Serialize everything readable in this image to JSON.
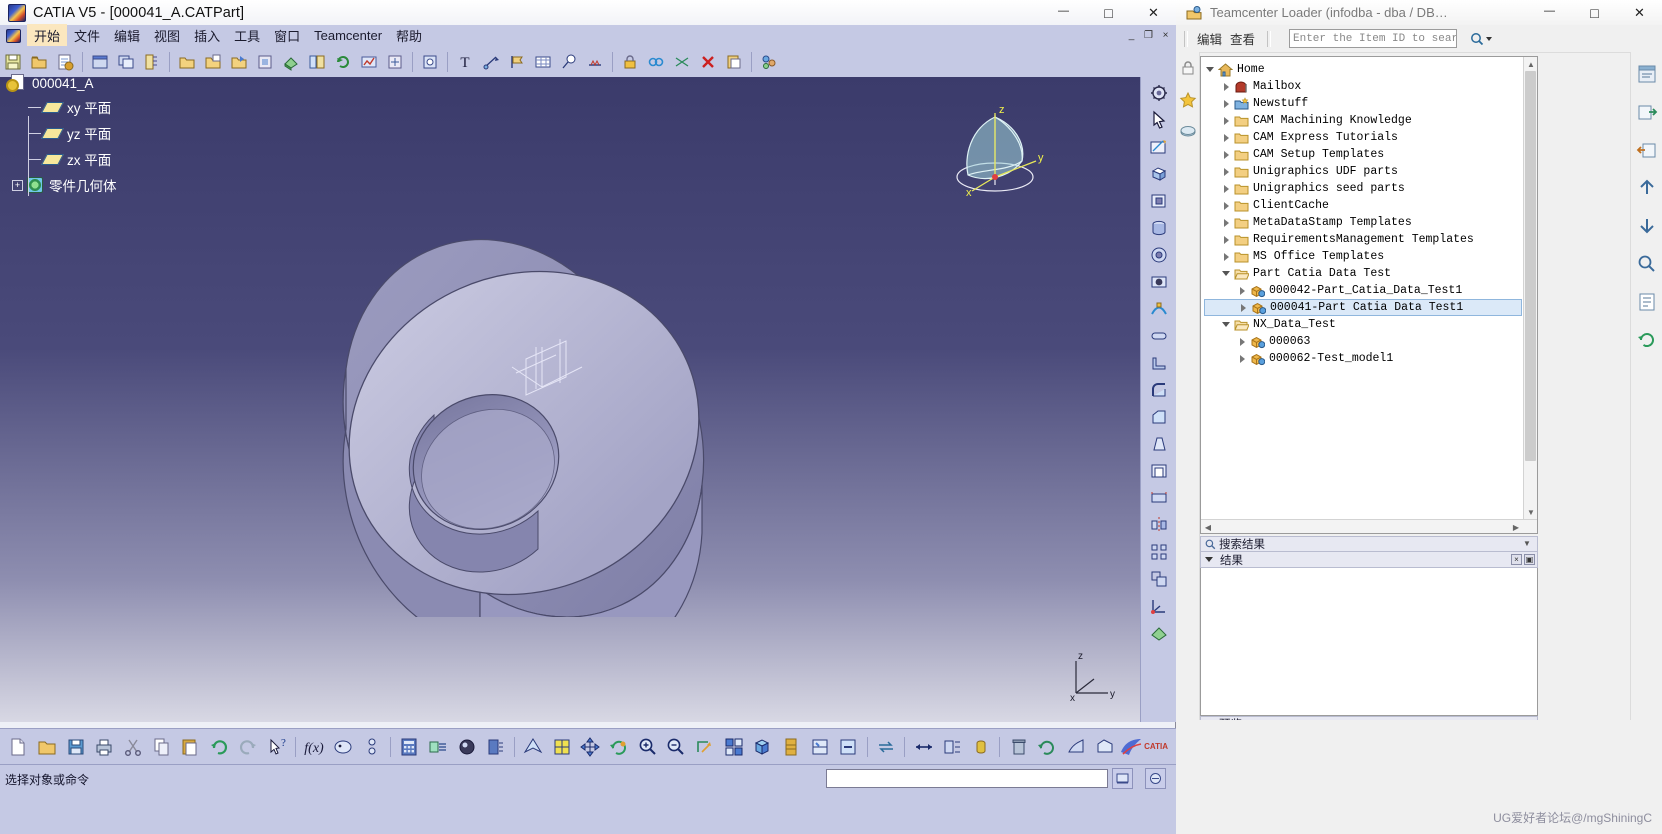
{
  "catia": {
    "title": "CATIA V5 - [000041_A.CATPart]",
    "app_icon": "catia-logo-icon",
    "window_controls": [
      {
        "name": "minimize-button",
        "glyph": "—"
      },
      {
        "name": "maximize-button",
        "glyph": "□"
      },
      {
        "name": "close-button",
        "glyph": "✕"
      }
    ],
    "menu": [
      {
        "label": "开始",
        "active": true
      },
      {
        "label": "文件",
        "active": false
      },
      {
        "label": "编辑",
        "active": false
      },
      {
        "label": "视图",
        "active": false
      },
      {
        "label": "插入",
        "active": false
      },
      {
        "label": "工具",
        "active": false
      },
      {
        "label": "窗口",
        "active": false
      },
      {
        "label": "Teamcenter",
        "active": false
      },
      {
        "label": "帮助",
        "active": false
      }
    ],
    "mdi_controls": [
      {
        "name": "mdi-minimize-button",
        "glyph": "_"
      },
      {
        "name": "mdi-restore-button",
        "glyph": "❐"
      },
      {
        "name": "mdi-close-button",
        "glyph": "×"
      }
    ],
    "spec_tree": {
      "root": "000041_A",
      "planes": [
        "xy 平面",
        "yz 平面",
        "zx 平面"
      ],
      "body": "零件几何体",
      "expander": "+"
    },
    "compass": {
      "x_label": "x",
      "y_label": "y",
      "z_label": "z"
    },
    "axis_triad": {
      "x_label": "x",
      "y_label": "y",
      "z_label": "z"
    },
    "logo_text": "CATIA",
    "status": {
      "message": "选择对象或命令",
      "command_value": "",
      "command_placeholder": ""
    },
    "top_toolbar_icons": [
      "save-icon",
      "open-folder-icon",
      "new-from-icon",
      "window-icon",
      "copy-window-icon",
      "measure-icon",
      "open-icon",
      "save-as-icon",
      "print-icon",
      "print-preview-icon",
      "apply-material-icon",
      "catalog-icon",
      "update-icon",
      "analyze-icon",
      "tools-icon",
      "power-copy-icon",
      "text-icon",
      "arrow-annotation-icon",
      "flag-note-icon",
      "table-icon",
      "balloon-icon",
      "weld-icon",
      "lock-icon",
      "link-icon",
      "constraint-icon",
      "delete-icon",
      "paste-special-icon",
      "assembly-icon"
    ],
    "right_toolbar_icons": [
      "gear-settings-icon",
      "select-arrow-icon",
      "sketcher-icon",
      "pad-icon",
      "pocket-icon",
      "shaft-icon",
      "groove-icon",
      "hole-icon",
      "rib-icon",
      "slot-icon",
      "stiffener-icon",
      "fillet-icon",
      "chamfer-icon",
      "draft-icon",
      "shell-icon",
      "thickness-icon",
      "mirror-icon",
      "pattern-icon",
      "scaling-icon",
      "axis-system-icon",
      "apply-material-icon"
    ],
    "bottom_toolbar_icons": [
      "new-document-icon",
      "open-document-icon",
      "save-document-icon",
      "print-icon",
      "cut-icon",
      "copy-icon",
      "paste-icon",
      "undo-icon",
      "redo-icon",
      "what-is-this-icon",
      "formula-icon",
      "knowledge-advisor-icon",
      "parameter-icon",
      "calculator-icon",
      "design-table-icon",
      "knowledge-inspector-icon",
      "lock-param-icon",
      "fly-mode-icon",
      "normal-view-icon",
      "pan-icon",
      "rotate-icon",
      "zoom-in-icon",
      "zoom-out-icon",
      "fit-all-icon",
      "multi-view-icon",
      "iso-view-icon",
      "cutting-plane-icon",
      "render-style-icon",
      "hide-show-icon",
      "swap-visible-icon",
      "dmu-navigator-icon",
      "measure-between-icon",
      "measure-item-icon",
      "measure-inertia-icon",
      "trash-icon",
      "history-icon",
      "sectioning-icon",
      "annotation-icon"
    ]
  },
  "teamcenter": {
    "title": "Teamcenter Loader (infodba - dba / DB…",
    "app_icon": "teamcenter-icon",
    "window_controls": [
      {
        "name": "minimize-button",
        "glyph": "—"
      },
      {
        "name": "maximize-button",
        "glyph": "□"
      },
      {
        "name": "close-button",
        "glyph": "✕"
      }
    ],
    "menu": [
      {
        "label": "编辑"
      },
      {
        "label": "查看"
      }
    ],
    "search": {
      "value": "",
      "placeholder": "Enter the Item ID to search",
      "button_icon": "search-icon",
      "dropdown_icon": "chevron-down-icon"
    },
    "tree": [
      {
        "label": "Home",
        "depth": 0,
        "state": "open",
        "icon": "home-icon"
      },
      {
        "label": "Mailbox",
        "depth": 1,
        "state": "closed",
        "icon": "mailbox-icon"
      },
      {
        "label": "Newstuff",
        "depth": 1,
        "state": "closed",
        "icon": "newstuff-icon"
      },
      {
        "label": "CAM Machining Knowledge",
        "depth": 1,
        "state": "closed",
        "icon": "folder-icon"
      },
      {
        "label": "CAM Express Tutorials",
        "depth": 1,
        "state": "closed",
        "icon": "folder-icon"
      },
      {
        "label": "CAM Setup Templates",
        "depth": 1,
        "state": "closed",
        "icon": "folder-icon"
      },
      {
        "label": "Unigraphics UDF parts",
        "depth": 1,
        "state": "closed",
        "icon": "folder-icon"
      },
      {
        "label": "Unigraphics seed parts",
        "depth": 1,
        "state": "closed",
        "icon": "folder-icon"
      },
      {
        "label": "ClientCache",
        "depth": 1,
        "state": "closed",
        "icon": "folder-icon"
      },
      {
        "label": "MetaDataStamp Templates",
        "depth": 1,
        "state": "closed",
        "icon": "folder-icon"
      },
      {
        "label": "RequirementsManagement Templates",
        "depth": 1,
        "state": "closed",
        "icon": "folder-icon"
      },
      {
        "label": "MS Office Templates",
        "depth": 1,
        "state": "closed",
        "icon": "folder-icon"
      },
      {
        "label": "Part Catia Data Test",
        "depth": 1,
        "state": "open",
        "icon": "folder-open-icon"
      },
      {
        "label": "000042-Part_Catia_Data_Test1",
        "depth": 2,
        "state": "closed",
        "icon": "item-icon"
      },
      {
        "label": "000041-Part Catia Data Test1",
        "depth": 2,
        "state": "closed",
        "icon": "item-icon",
        "selected": true
      },
      {
        "label": "NX_Data_Test",
        "depth": 1,
        "state": "open",
        "icon": "folder-open-icon"
      },
      {
        "label": "000063",
        "depth": 2,
        "state": "closed",
        "icon": "item-icon"
      },
      {
        "label": "000062-Test_model1",
        "depth": 2,
        "state": "closed",
        "icon": "item-icon"
      }
    ],
    "sections": {
      "search_results": {
        "label": "搜索结果",
        "icon": "search-icon"
      },
      "results": {
        "label": "结果",
        "buttons": [
          {
            "name": "results-close-button",
            "glyph": "×"
          },
          {
            "name": "results-pin-button",
            "glyph": "▣"
          }
        ]
      },
      "preview": {
        "label": "预览",
        "icon": "preview-icon"
      }
    },
    "left_rail_icons": [
      "lock-icon",
      "favorites-star-icon",
      "recent-icon"
    ],
    "right_rail_icons": [
      "panel-icon",
      "export-icon",
      "import-icon",
      "upload-icon",
      "download-icon",
      "search-panel-icon",
      "properties-icon",
      "refresh-icon"
    ]
  },
  "watermark": "UG爱好者论坛@/mgShiningC",
  "colors": {
    "catia_menu_bg": "#c5c9e4",
    "viewport_top": "#3b3b6b",
    "viewport_bottom": "#d8d8e4",
    "part_fill": "#b9b9d6",
    "selection_blue": "#dbe9f8",
    "folder_yellow": "#f6cf7a"
  }
}
